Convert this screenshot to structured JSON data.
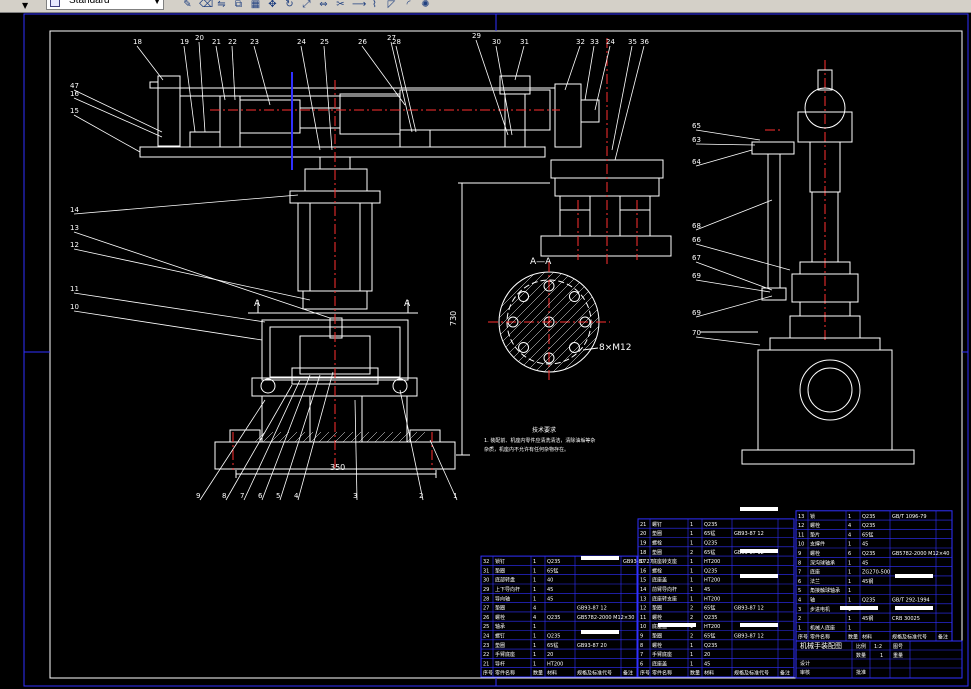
{
  "toolbar": {
    "text_style": "Standard",
    "tools": [
      "pencil-icon",
      "eraser-icon",
      "mirror-icon",
      "offset-icon",
      "array-icon",
      "move-icon",
      "rotate-icon",
      "scale-icon",
      "stretch-icon",
      "trim-icon",
      "extend-icon",
      "break-icon",
      "chamfer-icon",
      "fillet-icon",
      "explode-icon"
    ]
  },
  "drawing": {
    "callouts_top": [
      "18",
      "19",
      "20",
      "21",
      "22",
      "23",
      "24",
      "25",
      "26",
      "27",
      "28",
      "29",
      "30",
      "31",
      "32",
      "33",
      "24",
      "35",
      "36"
    ],
    "callouts_left": [
      "47",
      "16",
      "15",
      "14",
      "13",
      "12",
      "11",
      "10"
    ],
    "callouts_bottom": [
      "9",
      "8",
      "7",
      "6",
      "5",
      "4",
      "3",
      "2",
      "1"
    ],
    "callouts_right": [
      "65",
      "63",
      "64",
      "68",
      "66",
      "67",
      "69",
      "69",
      "70"
    ],
    "section_label_a": "A",
    "section_title": "A—A",
    "bolt_label": "8×M12",
    "dim_height": "730",
    "dim_width": "350",
    "note_title": "技术要求",
    "note_line1": "1. 装配前、机座内零件应清洗清洁，清除油垢等杂",
    "note_line2": "杂质，机座内不允许有任何杂物存在。"
  },
  "bom": {
    "tables": [
      {
        "rows": [
          [
            "32",
            "锁钉",
            "1",
            "Q235",
            "",
            "GB93-87 27"
          ],
          [
            "31",
            "垫圈",
            "1",
            "65锰",
            "",
            ""
          ],
          [
            "30",
            "底部转盘",
            "1",
            "40",
            "",
            ""
          ],
          [
            "29",
            "上下导向杆",
            "1",
            "45",
            "",
            ""
          ],
          [
            "28",
            "导向轴",
            "1",
            "45",
            "",
            ""
          ],
          [
            "27",
            "垫圈",
            "4",
            "",
            "GB93-87 12",
            ""
          ],
          [
            "26",
            "螺栓",
            "4",
            "Q235",
            "GB5782-2000 M12×30",
            ""
          ],
          [
            "25",
            "轴承",
            "1",
            "",
            "",
            ""
          ],
          [
            "24",
            "螺钉",
            "1",
            "Q235",
            "",
            ""
          ],
          [
            "23",
            "垫圈",
            "1",
            "65锰",
            "GB93-87 20",
            ""
          ],
          [
            "22",
            "手臂底座",
            "1",
            "20",
            "",
            ""
          ],
          [
            "21",
            "导杆",
            "1",
            "HT200",
            "",
            ""
          ]
        ],
        "footer": [
          "序号",
          "零件名称",
          "数量",
          "材料",
          "规格及标准代号",
          "备注"
        ]
      },
      {
        "rows": [
          [
            "21",
            "螺钉",
            "1",
            "Q235",
            "",
            ""
          ],
          [
            "20",
            "垫圈",
            "1",
            "65锰",
            "GB93-87 12",
            ""
          ],
          [
            "19",
            "螺栓",
            "1",
            "Q235",
            "",
            ""
          ],
          [
            "18",
            "垫圈",
            "2",
            "65锰",
            "GB93-87 12",
            ""
          ],
          [
            "17",
            "底座转支座",
            "1",
            "HT200",
            "",
            ""
          ],
          [
            "16",
            "螺栓",
            "1",
            "Q235",
            "",
            ""
          ],
          [
            "15",
            "底座盖",
            "1",
            "HT200",
            "",
            ""
          ],
          [
            "14",
            "前臂导向杆",
            "1",
            "45",
            "",
            ""
          ],
          [
            "13",
            "底座转支座",
            "1",
            "HT200",
            "",
            ""
          ],
          [
            "12",
            "垫圈",
            "2",
            "65锰",
            "GB93-87 12",
            ""
          ],
          [
            "11",
            "螺栓",
            "2",
            "Q235",
            "",
            ""
          ],
          [
            "10",
            "底座盖",
            "1",
            "HT200",
            "",
            ""
          ],
          [
            "9",
            "垫圈",
            "2",
            "65锰",
            "GB93-87 12",
            ""
          ],
          [
            "8",
            "螺栓",
            "1",
            "Q235",
            "",
            ""
          ],
          [
            "7",
            "手臂底座",
            "1",
            "20",
            "",
            ""
          ],
          [
            "6",
            "底座盖",
            "1",
            "45",
            "",
            ""
          ]
        ],
        "footer": [
          "序号",
          "零件名称",
          "数量",
          "材料",
          "规格及标准代号",
          "备注"
        ]
      },
      {
        "rows": [
          [
            "13",
            "锁",
            "1",
            "Q235",
            "GB/T 1096-79",
            ""
          ],
          [
            "12",
            "螺栓",
            "4",
            "Q235",
            "",
            ""
          ],
          [
            "11",
            "垫片",
            "4",
            "65锰",
            "",
            ""
          ],
          [
            "10",
            "支撑件",
            "1",
            "45",
            "",
            ""
          ],
          [
            "9",
            "螺栓",
            "6",
            "Q235",
            "GB5782-2000 M12×40",
            ""
          ],
          [
            "8",
            "深沟球轴承",
            "1",
            "45",
            "",
            ""
          ],
          [
            "7",
            "底座",
            "1",
            "ZG270-500",
            "",
            ""
          ],
          [
            "6",
            "法兰",
            "1",
            "45钢",
            "",
            ""
          ],
          [
            "5",
            "角接触球轴承",
            "1",
            "",
            "",
            ""
          ],
          [
            "4",
            "轴",
            "1",
            "Q235",
            "GB/T 292-1994",
            ""
          ],
          [
            "3",
            "步进电机",
            "1",
            "",
            "",
            ""
          ],
          [
            "2",
            "",
            "1",
            "45钢",
            "CRB 30025",
            ""
          ],
          [
            "1",
            "机械人底座",
            "1",
            "",
            "",
            ""
          ]
        ],
        "footer": [
          "序号",
          "零件名称",
          "数量",
          "材料",
          "规格及标准代号",
          "备注"
        ]
      }
    ],
    "title_block": {
      "title": "机械手装配图",
      "scale_label": "比例",
      "scale": "1:2",
      "qty_label": "数量",
      "qty": "1",
      "drawing_no_label": "图号",
      "material_label": "重量",
      "designer": "设计",
      "checker": "审核",
      "approver": "批准"
    }
  },
  "colors": {
    "background": "#000000",
    "line": "#ffffff",
    "frame": "#3030ff",
    "center": "#ff3030",
    "toolbar": "#d4d0c8"
  }
}
